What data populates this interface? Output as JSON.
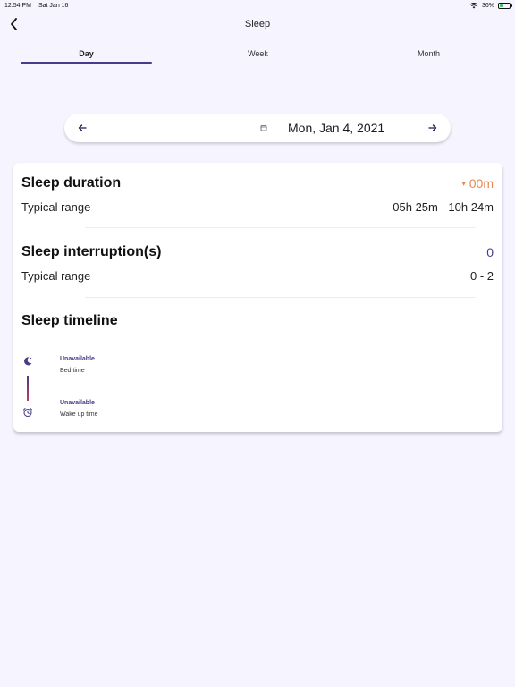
{
  "status_bar": {
    "time": "12:54 PM",
    "date": "Sat Jan 16",
    "battery": "36%",
    "battery_level": 0.36
  },
  "header": {
    "title": "Sleep",
    "back_icon": "chevron-left-icon"
  },
  "tabs": [
    {
      "label": "Day",
      "active": true
    },
    {
      "label": "Week",
      "active": false
    },
    {
      "label": "Month",
      "active": false
    }
  ],
  "date_selector": {
    "date": "Mon, Jan 4, 2021",
    "prev_icon": "arrow-left-icon",
    "next_icon": "arrow-right-icon",
    "calendar_icon": "calendar-icon"
  },
  "sleep_duration": {
    "title": "Sleep duration",
    "value": "00m",
    "value_indicator": "▾",
    "range_label": "Typical range",
    "range_value": "05h 25m - 10h 24m"
  },
  "sleep_interruptions": {
    "title": "Sleep interruption(s)",
    "value": "0",
    "range_label": "Typical range",
    "range_value": "0 - 2"
  },
  "sleep_timeline": {
    "title": "Sleep timeline",
    "bed": {
      "status": "Unavailable",
      "label": "Bed time",
      "icon": "moon-icon"
    },
    "wake": {
      "status": "Unavailable",
      "label": "Wake up time",
      "icon": "alarm-clock-icon"
    }
  },
  "colors": {
    "background": "#f6f4ff",
    "accent_purple": "#4a3a8c",
    "accent_orange": "#e8884f"
  }
}
